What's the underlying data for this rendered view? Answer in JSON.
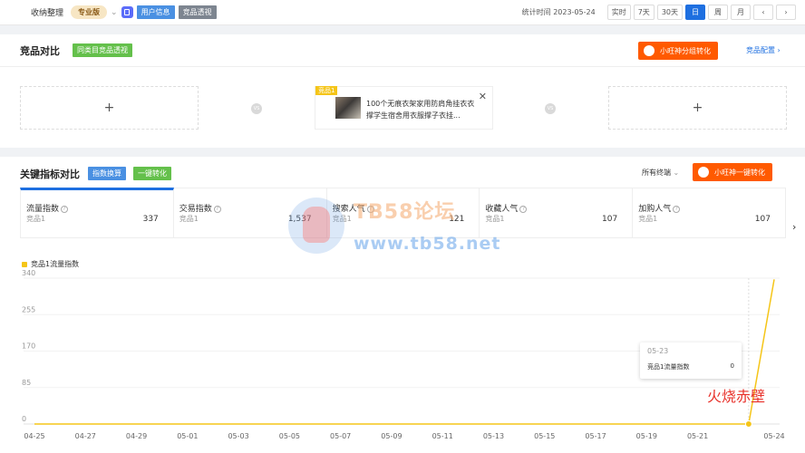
{
  "header": {
    "store_name": "收纳整理",
    "edition_badge": "专业版",
    "user_info_tag": "用户信息",
    "competitor_view_tag": "竞品透视",
    "stat_time": "统计时间 2023-05-24",
    "time_buttons": [
      "实时",
      "7天",
      "30天",
      "日",
      "周",
      "月"
    ],
    "active_time_button": "日",
    "prev_label": "‹",
    "next_label": "›"
  },
  "compare_panel": {
    "title": "竞品对比",
    "tag": "同类目竞品透视",
    "action_button": "小旺神分组转化",
    "config_link": "竞品配置 ›",
    "add_label": "+",
    "vs_label": "VS",
    "product": {
      "label": "竞品1",
      "title": "100个无痕衣架家用防肩角挂衣衣撑学生宿舍用衣服撑子衣挂...",
      "close": "✕"
    }
  },
  "metrics_panel": {
    "title": "关键指标对比",
    "tag_index": "指数换算",
    "tag_convert": "一键转化",
    "terminal_select": "所有终端",
    "action_button": "小旺神一键转化",
    "kpis": [
      {
        "name": "流量指数",
        "sub": "竞品1",
        "value": "337"
      },
      {
        "name": "交易指数",
        "sub": "竞品1",
        "value": "1,537"
      },
      {
        "name": "搜索人气",
        "sub": "竞品1",
        "value": "121"
      },
      {
        "name": "收藏人气",
        "sub": "竞品1",
        "value": "107"
      },
      {
        "name": "加购人气",
        "sub": "竞品1",
        "value": "107"
      }
    ],
    "next_arrow": "›"
  },
  "chart_data": {
    "type": "line",
    "series": [
      {
        "name": "竞品1流量指数",
        "color": "#f5c518",
        "x": [
          "04-25",
          "04-26",
          "04-27",
          "04-28",
          "04-29",
          "04-30",
          "05-01",
          "05-02",
          "05-03",
          "05-04",
          "05-05",
          "05-06",
          "05-07",
          "05-08",
          "05-09",
          "05-10",
          "05-11",
          "05-12",
          "05-13",
          "05-14",
          "05-15",
          "05-16",
          "05-17",
          "05-18",
          "05-19",
          "05-20",
          "05-21",
          "05-22",
          "05-23",
          "05-24"
        ],
        "values": [
          0,
          0,
          0,
          0,
          0,
          0,
          0,
          0,
          0,
          0,
          0,
          0,
          0,
          0,
          0,
          0,
          0,
          0,
          0,
          0,
          0,
          0,
          0,
          0,
          0,
          0,
          0,
          0,
          0,
          337
        ]
      }
    ],
    "x_tick_labels": [
      "04-25",
      "04-27",
      "04-29",
      "05-01",
      "05-03",
      "05-05",
      "05-07",
      "05-09",
      "05-11",
      "05-13",
      "05-15",
      "05-17",
      "05-19",
      "05-21",
      "05-24"
    ],
    "y_ticks": [
      0,
      85,
      170,
      255,
      340
    ],
    "ylim": [
      0,
      340
    ],
    "grid": true,
    "legend_position": "top-left",
    "tooltip": {
      "title": "05-23",
      "series": "竞品1流量指数",
      "value": "0"
    }
  },
  "watermark": {
    "title": "TB58论坛",
    "url": "www.tb58.net"
  },
  "signature": "火烧赤壁"
}
